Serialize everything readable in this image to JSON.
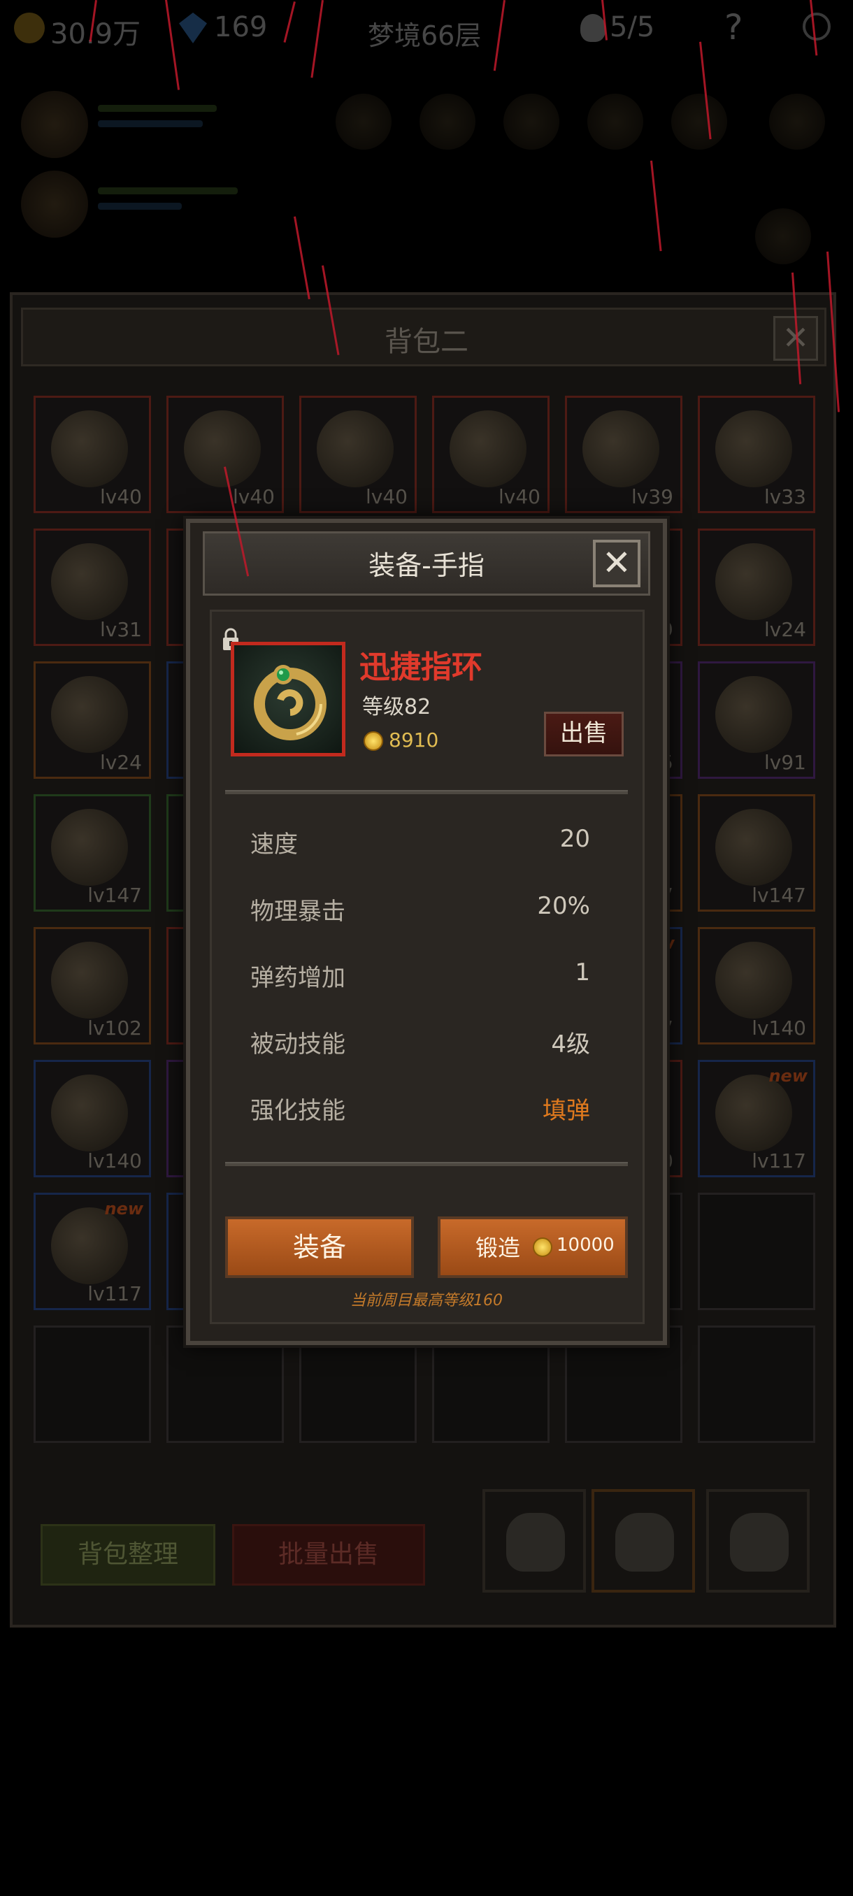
{
  "hud": {
    "coins": "30.9万",
    "gems": "169",
    "floor": "梦境66层",
    "lives": "5/5",
    "help": "?"
  },
  "bag": {
    "title": "背包二",
    "close": "✕",
    "slots": [
      {
        "lv": "lv40",
        "rarity": "red",
        "new": ""
      },
      {
        "lv": "lv40",
        "rarity": "red",
        "new": ""
      },
      {
        "lv": "lv40",
        "rarity": "red",
        "new": ""
      },
      {
        "lv": "lv40",
        "rarity": "red",
        "new": ""
      },
      {
        "lv": "lv39",
        "rarity": "red",
        "new": ""
      },
      {
        "lv": "lv33",
        "rarity": "red",
        "new": ""
      },
      {
        "lv": "lv31",
        "rarity": "red",
        "new": ""
      },
      {
        "lv": "",
        "rarity": "red",
        "new": ""
      },
      {
        "lv": "",
        "rarity": "red",
        "new": ""
      },
      {
        "lv": "",
        "rarity": "red",
        "new": ""
      },
      {
        "lv": "9",
        "rarity": "red",
        "new": ""
      },
      {
        "lv": "lv24",
        "rarity": "red",
        "new": ""
      },
      {
        "lv": "lv24",
        "rarity": "orange",
        "new": ""
      },
      {
        "lv": "",
        "rarity": "blue",
        "new": ""
      },
      {
        "lv": "",
        "rarity": "red",
        "new": ""
      },
      {
        "lv": "",
        "rarity": "red",
        "new": ""
      },
      {
        "lv": "5",
        "rarity": "purple",
        "new": ""
      },
      {
        "lv": "lv91",
        "rarity": "purple",
        "new": ""
      },
      {
        "lv": "lv147",
        "rarity": "green",
        "new": ""
      },
      {
        "lv": "",
        "rarity": "green",
        "new": ""
      },
      {
        "lv": "",
        "rarity": "red",
        "new": ""
      },
      {
        "lv": "",
        "rarity": "red",
        "new": ""
      },
      {
        "lv": "7",
        "rarity": "orange",
        "new": ""
      },
      {
        "lv": "lv147",
        "rarity": "orange",
        "new": ""
      },
      {
        "lv": "lv102",
        "rarity": "orange",
        "new": ""
      },
      {
        "lv": "",
        "rarity": "red",
        "new": ""
      },
      {
        "lv": "",
        "rarity": "red",
        "new": ""
      },
      {
        "lv": "",
        "rarity": "red",
        "new": ""
      },
      {
        "lv": "7",
        "rarity": "blue",
        "new": "new"
      },
      {
        "lv": "lv140",
        "rarity": "orange",
        "new": ""
      },
      {
        "lv": "lv140",
        "rarity": "blue",
        "new": ""
      },
      {
        "lv": "",
        "rarity": "purple",
        "new": ""
      },
      {
        "lv": "",
        "rarity": "red",
        "new": ""
      },
      {
        "lv": "",
        "rarity": "red",
        "new": ""
      },
      {
        "lv": "0",
        "rarity": "red",
        "new": ""
      },
      {
        "lv": "lv117",
        "rarity": "blue",
        "new": "new"
      },
      {
        "lv": "lv117",
        "rarity": "blue",
        "new": "new"
      },
      {
        "lv": "",
        "rarity": "blue",
        "new": ""
      },
      {
        "lv": "",
        "rarity": "empty",
        "new": ""
      },
      {
        "lv": "",
        "rarity": "empty",
        "new": ""
      },
      {
        "lv": "",
        "rarity": "empty",
        "new": ""
      },
      {
        "lv": "",
        "rarity": "empty",
        "new": ""
      },
      {
        "lv": "",
        "rarity": "empty",
        "new": ""
      },
      {
        "lv": "",
        "rarity": "empty",
        "new": ""
      },
      {
        "lv": "",
        "rarity": "empty",
        "new": ""
      },
      {
        "lv": "",
        "rarity": "empty",
        "new": ""
      },
      {
        "lv": "",
        "rarity": "empty",
        "new": ""
      },
      {
        "lv": "",
        "rarity": "empty",
        "new": ""
      }
    ],
    "sort_label": "背包整理",
    "bulk_sell_label": "批量出售"
  },
  "modal": {
    "title": "装备-手指",
    "close": "✕",
    "item": {
      "name": "迅捷指环",
      "level": "等级82",
      "price": "8910"
    },
    "sell_label": "出售",
    "stats": [
      {
        "label": "速度",
        "value": "20"
      },
      {
        "label": "物理暴击",
        "value": "20%"
      },
      {
        "label": "弹药增加",
        "value": "1"
      },
      {
        "label": "被动技能",
        "value": "4级"
      },
      {
        "label": "强化技能",
        "value": "填弹"
      }
    ],
    "equip_label": "装备",
    "forge_label": "锻造",
    "forge_cost": "10000",
    "hint": "当前周目最高等级160"
  },
  "colors": {
    "item_name": "#e03a2c",
    "price": "#e1bc52",
    "special_stat": "#e07a1e",
    "button": "#c86a2a",
    "rain": "#c0192a"
  }
}
